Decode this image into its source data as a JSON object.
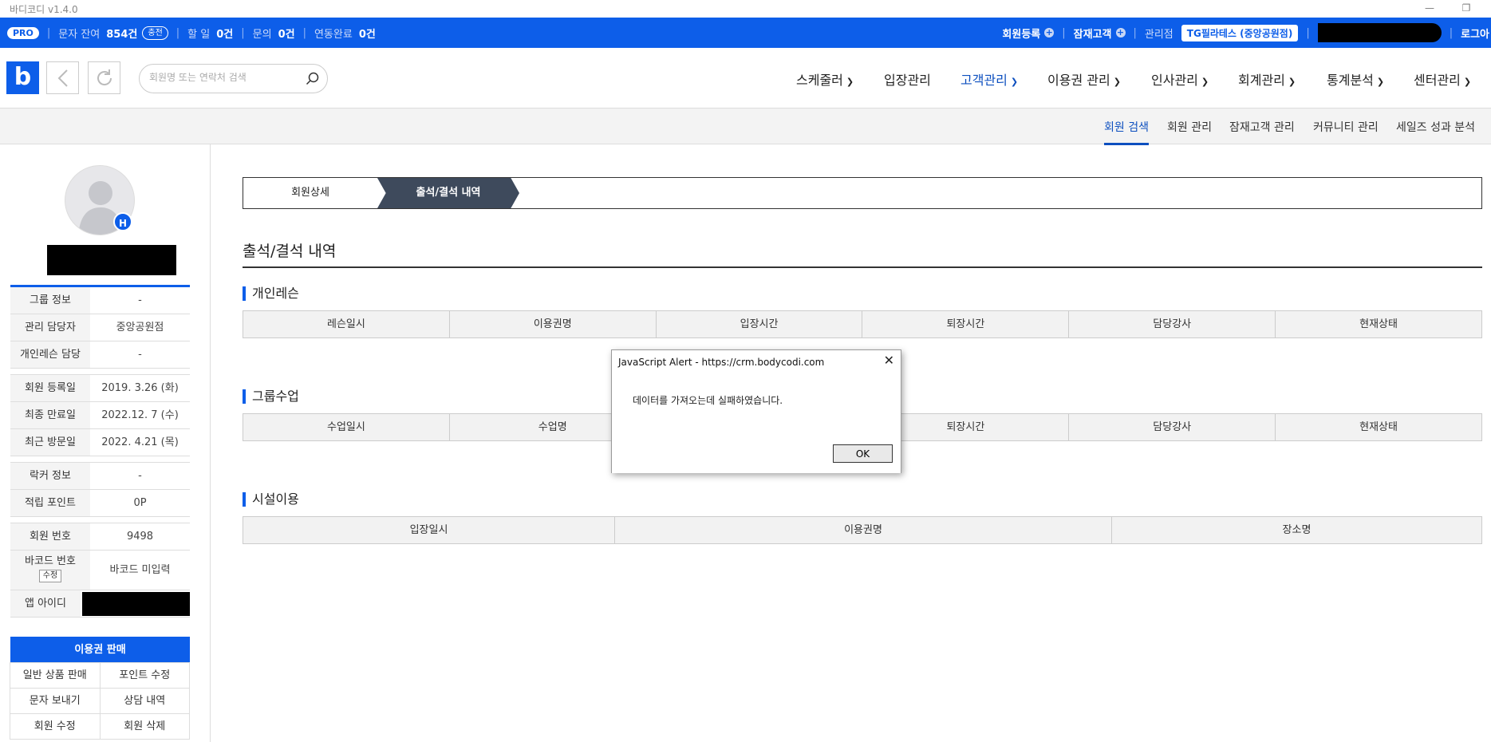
{
  "app": {
    "title": "바디코디 v1.4.0"
  },
  "topbar": {
    "pro": "PRO",
    "sms_label": "문자 잔여",
    "sms_value": "854건",
    "charge": "충전",
    "todo_label": "할 일",
    "todo_value": "0건",
    "inquiry_label": "문의",
    "inquiry_value": "0건",
    "renew_label": "연동완료",
    "renew_value": "0건",
    "register_member": "회원등록",
    "potential_customer": "잠재고객",
    "manager_label": "관리점",
    "branch": "TG필라테스 (중앙공원점)",
    "logout": "로그아"
  },
  "nav": {
    "logo": "b",
    "search_placeholder": "회원명 또는 연락처 검색",
    "menus": [
      "스케줄러",
      "입장관리",
      "고객관리",
      "이용권 관리",
      "인사관리",
      "회계관리",
      "통계분석",
      "센터관리"
    ]
  },
  "subnav": [
    "회원 검색",
    "회원 관리",
    "잠재고객 관리",
    "커뮤니티 관리",
    "세일즈 성과 분석"
  ],
  "sidebar": {
    "avatar_badge": "H",
    "info": [
      {
        "k": "그룹 정보",
        "v": "-"
      },
      {
        "k": "관리 담당자",
        "v": "중앙공원점"
      },
      {
        "k": "개인레슨 담당",
        "v": "-"
      },
      {
        "k": "회원 등록일",
        "v": "2019. 3.26 (화)"
      },
      {
        "k": "최종 만료일",
        "v": "2022.12. 7 (수)"
      },
      {
        "k": "최근 방문일",
        "v": "2022. 4.21 (목)"
      },
      {
        "k": "락커 정보",
        "v": "-"
      },
      {
        "k": "적립 포인트",
        "v": "0P"
      },
      {
        "k": "회원 번호",
        "v": "9498"
      },
      {
        "k": "바코드 번호",
        "v": "바코드 미입력"
      },
      {
        "k": "앱 아이디",
        "v": ""
      }
    ],
    "barcode_edit": "수정",
    "sale_head": "이용권 판매",
    "sale_items": [
      "일반 상품 판매",
      "포인트 수정",
      "문자 보내기",
      "상담 내역",
      "회원 수정",
      "회원 삭제"
    ]
  },
  "main": {
    "tab_detail": "회원상세",
    "tab_attendance": "출석/결석 내역",
    "page_title": "출석/결석 내역",
    "sections": [
      {
        "title": "개인레슨",
        "cols": [
          "레슨일시",
          "이용권명",
          "입장시간",
          "퇴장시간",
          "담당강사",
          "현재상태"
        ]
      },
      {
        "title": "그룹수업",
        "cols": [
          "수업일시",
          "수업명",
          "",
          "퇴장시간",
          "담당강사",
          "현재상태"
        ]
      },
      {
        "title": "시설이용",
        "cols": [
          "입장일시",
          "이용권명",
          "장소명"
        ]
      }
    ]
  },
  "dialog": {
    "title": "JavaScript Alert - https://crm.bodycodi.com",
    "message": "데이터를 가져오는데 실패하였습니다.",
    "ok": "OK"
  },
  "colors": {
    "brand": "#0d5ee9",
    "tab_active": "#3e4a5c"
  }
}
